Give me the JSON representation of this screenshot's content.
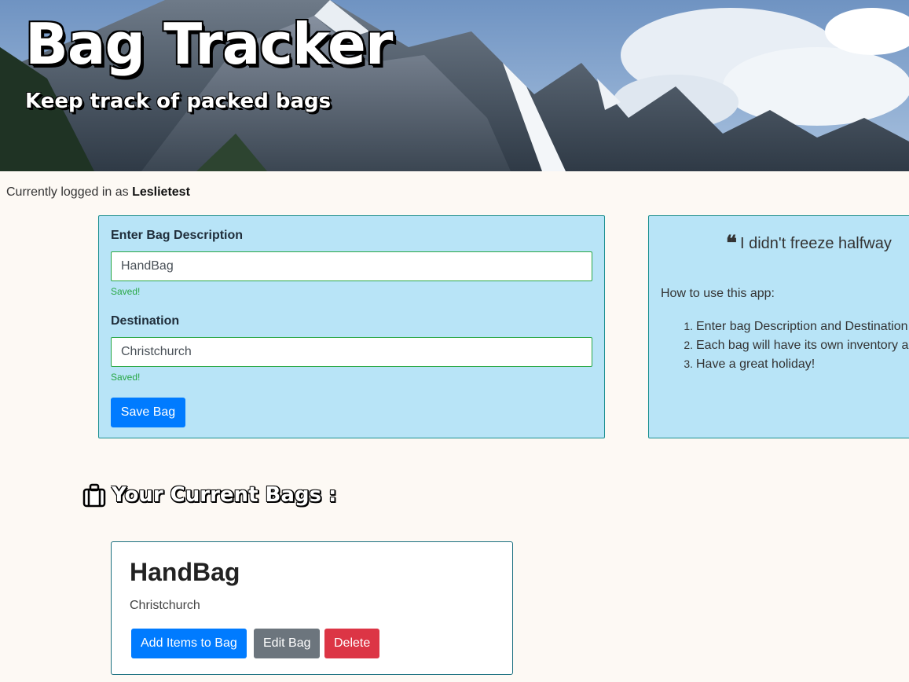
{
  "header": {
    "title": "Bag Tracker",
    "subtitle": "Keep track of packed bags"
  },
  "login": {
    "prefix": "Currently logged in as",
    "username": "Leslietest"
  },
  "form": {
    "description_label": "Enter Bag Description",
    "description_value": "HandBag",
    "description_status": "Saved!",
    "destination_label": "Destination",
    "destination_value": "Christchurch",
    "destination_status": "Saved!",
    "save_button": "Save Bag"
  },
  "info": {
    "quote_icon": "quote-left-icon",
    "quote": "I didn't freeze halfway",
    "how_to_title": "How to use this app:",
    "steps": [
      {
        "num": "1.",
        "text": "Enter bag Description and Destination"
      },
      {
        "num": "2.",
        "text": "Each bag will have its own inventory a"
      },
      {
        "num": "3.",
        "text": "Have a great holiday!"
      }
    ]
  },
  "bags_section": {
    "icon": "suitcase-icon",
    "title": "Your Current Bags :"
  },
  "bags": [
    {
      "name": "HandBag",
      "destination": "Christchurch",
      "add_items_button": "Add Items to Bag",
      "edit_button": "Edit Bag",
      "delete_button": "Delete"
    }
  ],
  "colors": {
    "panel_bg": "#b8e4f7",
    "primary": "#007bff",
    "secondary": "#6c757d",
    "danger": "#dc3545",
    "success": "#28a745",
    "page_bg": "#fdf9f4"
  }
}
